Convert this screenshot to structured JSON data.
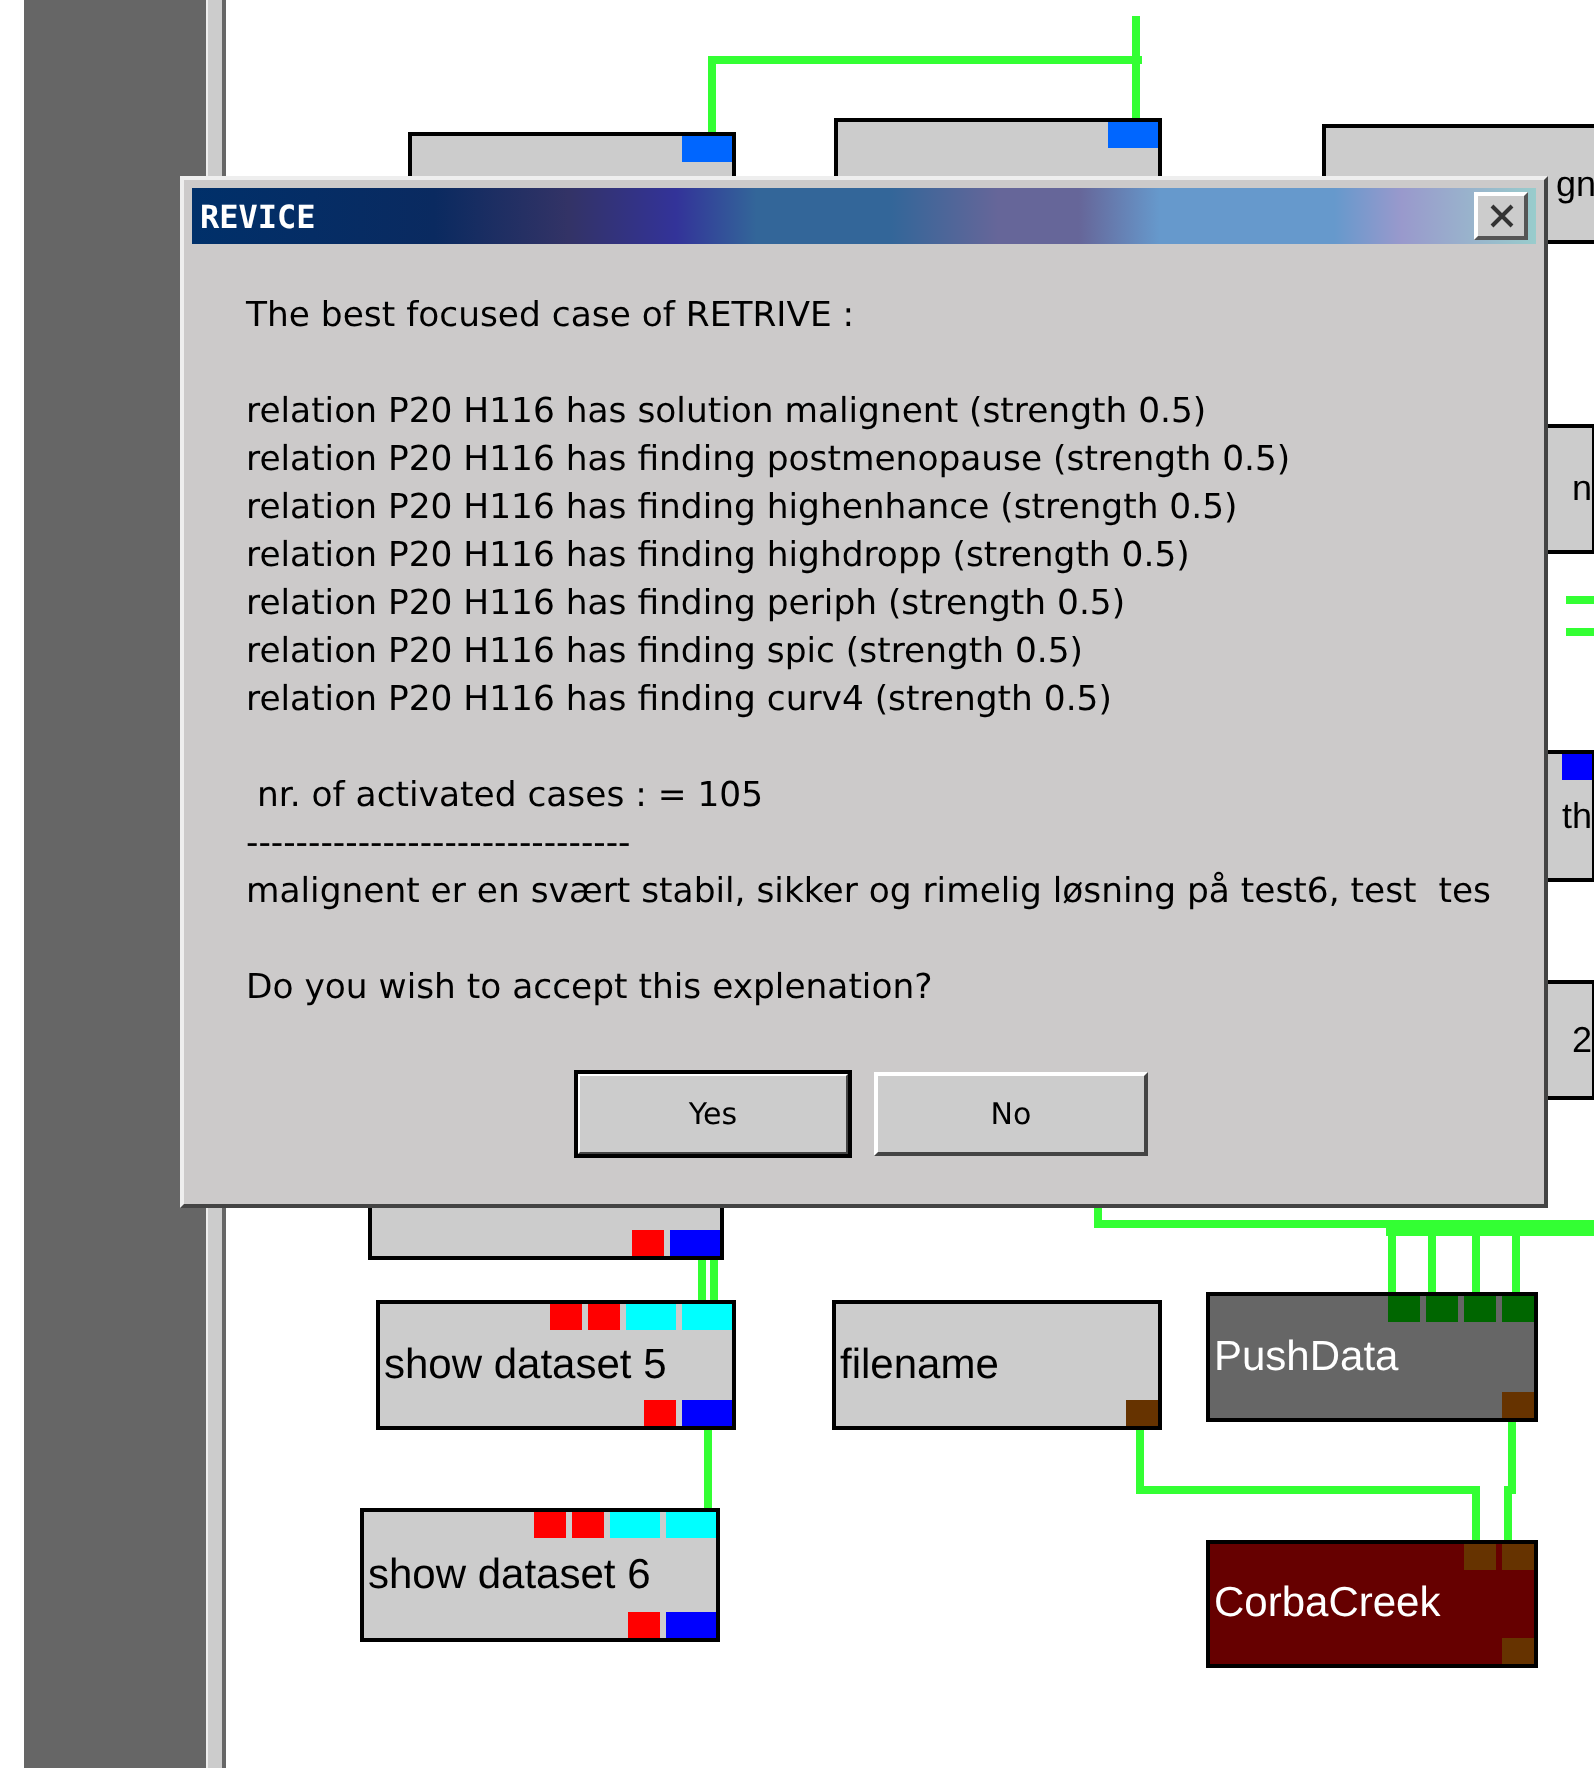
{
  "nodes": [
    {
      "color": "#cccccc",
      "top_ports": [
        {
          "kind": "data",
          "color": "#0066ff"
        }
      ]
    },
    {
      "color": "#cccccc",
      "top_ports": [
        {
          "kind": "data",
          "color": "#0066ff"
        }
      ]
    },
    {
      "label": "gn",
      "color": "#cccccc"
    },
    {
      "label": "n",
      "color": "#cccccc"
    },
    {
      "label": "th",
      "color": "#cccccc",
      "top_ports": [
        {
          "kind": "wide",
          "color": "#0000ff"
        }
      ]
    },
    {
      "label": "2",
      "color": "#cccccc"
    },
    {
      "color": "#cccccc",
      "bottom_ports": [
        {
          "kind": "signal",
          "color": "#ff0000"
        },
        {
          "kind": "data",
          "color": "#0000ff"
        }
      ]
    },
    {
      "label": "show dataset 5",
      "color": "#cccccc",
      "top_ports": [
        {
          "kind": "signal",
          "color": "#ff0000"
        },
        {
          "kind": "signal",
          "color": "#ff0000"
        },
        {
          "kind": "data",
          "color": "#00ffff"
        },
        {
          "kind": "data",
          "color": "#00ffff"
        }
      ],
      "bottom_ports": [
        {
          "kind": "signal",
          "color": "#ff0000"
        },
        {
          "kind": "data",
          "color": "#0000ff"
        }
      ]
    },
    {
      "label": "filename",
      "color": "#cccccc",
      "bottom_ports": [
        {
          "kind": "signal",
          "color": "#663300"
        }
      ]
    },
    {
      "label": "PushData",
      "color": "#666666",
      "top_ports": [
        {
          "kind": "signal",
          "color": "#006600"
        },
        {
          "kind": "signal",
          "color": "#006600"
        },
        {
          "kind": "signal",
          "color": "#006600"
        },
        {
          "kind": "signal",
          "color": "#006600"
        }
      ],
      "bottom_ports": [
        {
          "kind": "signal",
          "color": "#663300"
        }
      ]
    },
    {
      "label": "show dataset 6",
      "color": "#cccccc",
      "top_ports": [
        {
          "kind": "signal",
          "color": "#ff0000"
        },
        {
          "kind": "signal",
          "color": "#ff0000"
        },
        {
          "kind": "data",
          "color": "#00ffff"
        },
        {
          "kind": "data",
          "color": "#00ffff"
        }
      ],
      "bottom_ports": [
        {
          "kind": "signal",
          "color": "#ff0000"
        },
        {
          "kind": "data",
          "color": "#0000ff"
        }
      ]
    },
    {
      "label": "CorbaCreek",
      "color": "#660000",
      "top_ports": [
        {
          "kind": "signal",
          "color": "#663300"
        },
        {
          "kind": "signal",
          "color": "#663300"
        }
      ],
      "bottom_ports": [
        {
          "kind": "signal",
          "color": "#663300"
        }
      ]
    }
  ],
  "dialog": {
    "title": "REVICE",
    "paragraphs": [
      [
        "The best focused case of RETRIVE :"
      ],
      [
        "relation P20 H116 has solution malignent (strength 0.5)",
        "relation P20 H116 has finding postmenopause (strength 0.5)",
        "relation P20 H116 has finding highenhance (strength 0.5)",
        "relation P20 H116 has finding highdropp (strength 0.5)",
        "relation P20 H116 has finding periph (strength 0.5)",
        "relation P20 H116 has finding spic (strength 0.5)",
        "relation P20 H116 has finding curv4 (strength 0.5)"
      ],
      [
        " nr. of activated cases : = 105",
        "-------------------------------",
        "malignent er en svært stabil, sikker og rimelig løsning på test6, test  tes"
      ],
      [
        "Do you wish to accept this explenation?"
      ]
    ],
    "buttons": [
      {
        "label": "Yes",
        "default": true
      },
      {
        "label": "No",
        "default": false
      }
    ]
  }
}
